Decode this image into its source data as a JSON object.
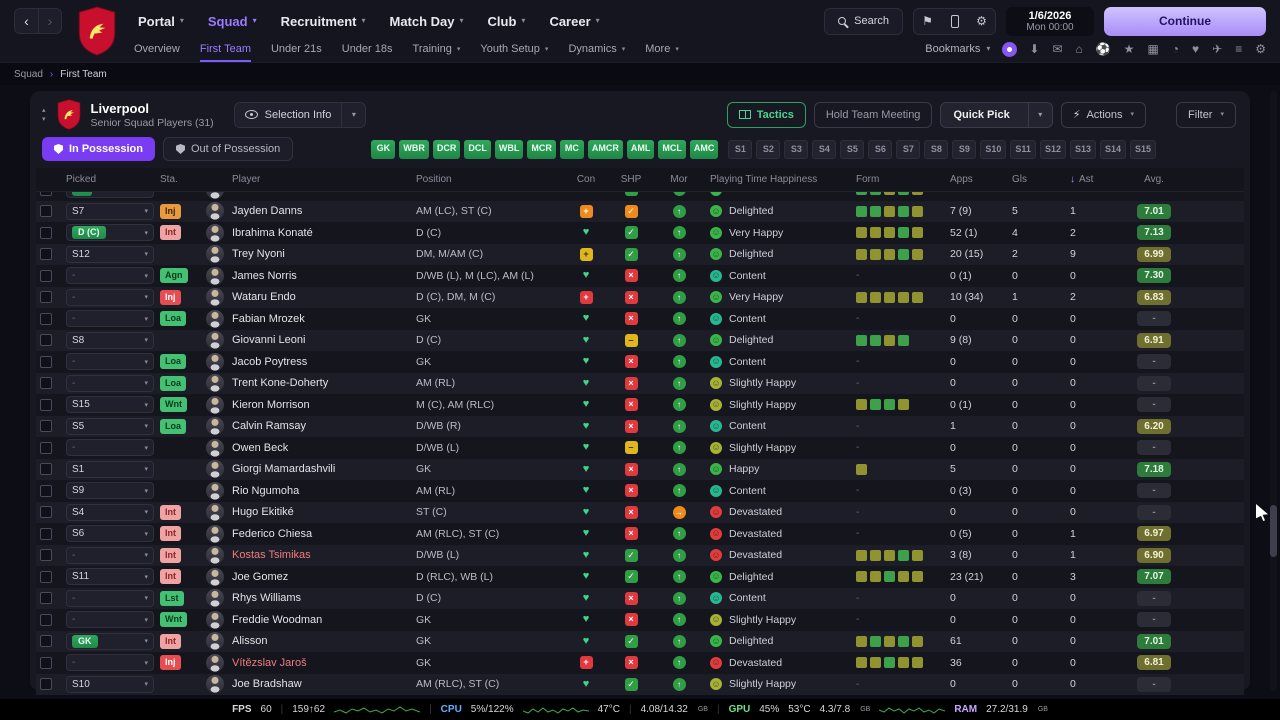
{
  "topbar": {
    "back": "‹",
    "forward": "›",
    "nav": [
      {
        "label": "Portal"
      },
      {
        "label": "Squad",
        "active": true
      },
      {
        "label": "Recruitment"
      },
      {
        "label": "Match Day"
      },
      {
        "label": "Club"
      },
      {
        "label": "Career"
      }
    ],
    "search_label": "Search",
    "date_line1": "1/6/2026",
    "date_line2": "Mon 00:00",
    "continue_label": "Continue"
  },
  "subnav": {
    "items": [
      {
        "label": "Overview"
      },
      {
        "label": "First Team",
        "active": true
      },
      {
        "label": "Under 21s"
      },
      {
        "label": "Under 18s"
      },
      {
        "label": "Training",
        "caret": true
      },
      {
        "label": "Youth Setup",
        "caret": true
      },
      {
        "label": "Dynamics",
        "caret": true
      },
      {
        "label": "More",
        "caret": true
      }
    ],
    "bookmarks_label": "Bookmarks",
    "icons": [
      {
        "name": "downloads-icon",
        "glyph": "⬇"
      },
      {
        "name": "mail-icon",
        "glyph": "✉"
      },
      {
        "name": "home-icon",
        "glyph": "⌂"
      },
      {
        "name": "club-icon",
        "glyph": "⚽"
      },
      {
        "name": "favourites-icon",
        "glyph": "★"
      },
      {
        "name": "calendar-icon",
        "glyph": "▦"
      },
      {
        "name": "history-icon",
        "glyph": "◔"
      },
      {
        "name": "medical-icon",
        "glyph": "♥"
      },
      {
        "name": "travel-icon",
        "glyph": "✈"
      },
      {
        "name": "menu-icon",
        "glyph": "≡"
      },
      {
        "name": "preferences-icon",
        "glyph": "⚙"
      }
    ]
  },
  "breadcrumb": [
    "Squad",
    "First Team"
  ],
  "panel": {
    "club_name": "Liverpool",
    "subtitle": "Senior Squad Players (31)",
    "selection_info_label": "Selection Info",
    "tactics_label": "Tactics",
    "meeting_label": "Hold Team Meeting",
    "quick_pick_label": "Quick Pick",
    "actions_label": "Actions",
    "filter_label": "Filter",
    "in_possession_label": "In Possession",
    "out_possession_label": "Out of Possession",
    "position_chips": [
      "GK",
      "WBR",
      "DCR",
      "DCL",
      "WBL",
      "MCR",
      "MC",
      "AMCR",
      "AML",
      "MCL",
      "AMC"
    ],
    "slot_chips": [
      "S1",
      "S2",
      "S3",
      "S4",
      "S5",
      "S6",
      "S7",
      "S8",
      "S9",
      "S10",
      "S11",
      "S12",
      "S13",
      "S14",
      "S15"
    ]
  },
  "table": {
    "headers": {
      "picked": "Picked",
      "sta": "Sta.",
      "player": "Player",
      "position": "Position",
      "con": "Con",
      "shp": "SHP",
      "mor": "Mor",
      "happiness": "Playing Time Happiness",
      "form": "Form",
      "apps": "Apps",
      "gls": "Gls",
      "ast": "Ast",
      "avg": "Avg.",
      "sort_icon": "↓"
    },
    "rows": [
      {
        "partial": true,
        "picked_label": "",
        "picked_type": "pos",
        "sta_label": "",
        "sta_color": "",
        "name": "",
        "name_red": false,
        "position": "",
        "con": "heart",
        "shp": "check",
        "mor": "up",
        "hap_label": "",
        "hap_color": "green",
        "form": [
          "g",
          "g",
          "o",
          "g",
          "o"
        ],
        "apps": "",
        "gls": "",
        "ast": "",
        "avg": "",
        "avg_level": "hidden"
      },
      {
        "partial": false,
        "picked_label": "S7",
        "picked_type": "slot",
        "sta_label": "Inj",
        "sta_color": "orange",
        "name": "Jayden Danns",
        "name_red": false,
        "position": "AM (LC), ST (C)",
        "con": "knock",
        "shp": "okay",
        "mor": "up",
        "hap_label": "Delighted",
        "hap_color": "green",
        "form": [
          "g",
          "g",
          "o",
          "g",
          "o"
        ],
        "apps": "7 (9)",
        "gls": "5",
        "ast": "1",
        "avg": "7.01",
        "avg_level": "good"
      },
      {
        "partial": false,
        "picked_label": "D (C)",
        "picked_type": "pos",
        "sta_label": "Int",
        "sta_color": "pink",
        "name": "Ibrahima Konaté",
        "name_red": false,
        "position": "D (C)",
        "con": "heart",
        "shp": "check",
        "mor": "up",
        "hap_label": "Very Happy",
        "hap_color": "green",
        "form": [
          "o",
          "o",
          "o",
          "g",
          "o"
        ],
        "apps": "52 (1)",
        "gls": "4",
        "ast": "2",
        "avg": "7.13",
        "avg_level": "good"
      },
      {
        "partial": false,
        "picked_label": "S12",
        "picked_type": "slot",
        "sta_label": "",
        "sta_color": "",
        "name": "Trey Nyoni",
        "name_red": false,
        "position": "DM, M/AM (C)",
        "con": "warn",
        "shp": "check",
        "mor": "up",
        "hap_label": "Delighted",
        "hap_color": "green",
        "form": [
          "o",
          "o",
          "o",
          "g",
          "o"
        ],
        "apps": "20 (15)",
        "gls": "2",
        "ast": "9",
        "avg": "6.99",
        "avg_level": "ok"
      },
      {
        "partial": false,
        "picked_label": "-",
        "picked_type": "dash",
        "sta_label": "Agn",
        "sta_color": "green",
        "name": "James Norris",
        "name_red": false,
        "position": "D/WB (L), M (LC), AM (L)",
        "con": "heart",
        "shp": "cross",
        "mor": "up",
        "hap_label": "Content",
        "hap_color": "teal",
        "form": null,
        "apps": "0 (1)",
        "gls": "0",
        "ast": "0",
        "avg": "7.30",
        "avg_level": "good"
      },
      {
        "partial": false,
        "picked_label": "-",
        "picked_type": "dash",
        "sta_label": "Inj",
        "sta_color": "red",
        "name": "Wataru Endo",
        "name_red": false,
        "position": "D (C), DM, M (C)",
        "con": "cross",
        "shp": "cross",
        "mor": "up",
        "hap_label": "Very Happy",
        "hap_color": "green",
        "form": [
          "o",
          "o",
          "o",
          "o",
          "o"
        ],
        "apps": "10 (34)",
        "gls": "1",
        "ast": "2",
        "avg": "6.83",
        "avg_level": "ok"
      },
      {
        "partial": false,
        "picked_label": "-",
        "picked_type": "dash",
        "sta_label": "Loa",
        "sta_color": "green",
        "name": "Fabian Mrozek",
        "name_red": false,
        "position": "GK",
        "con": "heart",
        "shp": "cross",
        "mor": "up",
        "hap_label": "Content",
        "hap_color": "teal",
        "form": null,
        "apps": "0",
        "gls": "0",
        "ast": "0",
        "avg": "-",
        "avg_level": "none"
      },
      {
        "partial": false,
        "picked_label": "S8",
        "picked_type": "slot",
        "sta_label": "",
        "sta_color": "",
        "name": "Giovanni Leoni",
        "name_red": false,
        "position": "D (C)",
        "con": "heart",
        "shp": "dash",
        "mor": "up",
        "hap_label": "Delighted",
        "hap_color": "green",
        "form": [
          "g",
          "g",
          "o",
          "g"
        ],
        "apps": "9 (8)",
        "gls": "0",
        "ast": "0",
        "avg": "6.91",
        "avg_level": "ok"
      },
      {
        "partial": false,
        "picked_label": "-",
        "picked_type": "dash",
        "sta_label": "Loa",
        "sta_color": "green",
        "name": "Jacob Poytress",
        "name_red": false,
        "position": "GK",
        "con": "heart",
        "shp": "cross",
        "mor": "up",
        "hap_label": "Content",
        "hap_color": "teal",
        "form": null,
        "apps": "0",
        "gls": "0",
        "ast": "0",
        "avg": "-",
        "avg_level": "none"
      },
      {
        "partial": false,
        "picked_label": "-",
        "picked_type": "dash",
        "sta_label": "Loa",
        "sta_color": "green",
        "name": "Trent Kone-Doherty",
        "name_red": false,
        "position": "AM (RL)",
        "con": "heart",
        "shp": "cross",
        "mor": "up",
        "hap_label": "Slightly Happy",
        "hap_color": "olive",
        "form": null,
        "apps": "0",
        "gls": "0",
        "ast": "0",
        "avg": "-",
        "avg_level": "none"
      },
      {
        "partial": false,
        "picked_label": "S15",
        "picked_type": "slot",
        "sta_label": "Wnt",
        "sta_color": "green",
        "name": "Kieron Morrison",
        "name_red": false,
        "position": "M (C), AM (RLC)",
        "con": "heart",
        "shp": "cross",
        "mor": "up",
        "hap_label": "Slightly Happy",
        "hap_color": "olive",
        "form": [
          "o",
          "g",
          "g",
          "o"
        ],
        "apps": "0 (1)",
        "gls": "0",
        "ast": "0",
        "avg": "-",
        "avg_level": "none"
      },
      {
        "partial": false,
        "picked_label": "S5",
        "picked_type": "slot",
        "sta_label": "Loa",
        "sta_color": "green",
        "name": "Calvin Ramsay",
        "name_red": false,
        "position": "D/WB (R)",
        "con": "heart",
        "shp": "cross",
        "mor": "up",
        "hap_label": "Content",
        "hap_color": "teal",
        "form": null,
        "apps": "1",
        "gls": "0",
        "ast": "0",
        "avg": "6.20",
        "avg_level": "ok"
      },
      {
        "partial": false,
        "picked_label": "-",
        "picked_type": "dash",
        "sta_label": "",
        "sta_color": "",
        "name": "Owen Beck",
        "name_red": false,
        "position": "D/WB (L)",
        "con": "heart",
        "shp": "dash",
        "mor": "up",
        "hap_label": "Slightly Happy",
        "hap_color": "olive",
        "form": null,
        "apps": "0",
        "gls": "0",
        "ast": "0",
        "avg": "-",
        "avg_level": "none"
      },
      {
        "partial": false,
        "picked_label": "S1",
        "picked_type": "slot",
        "sta_label": "",
        "sta_color": "",
        "name": "Giorgi Mamardashvili",
        "name_red": false,
        "position": "GK",
        "con": "heart",
        "shp": "cross",
        "mor": "up",
        "hap_label": "Happy",
        "hap_color": "green",
        "form": [
          "o"
        ],
        "apps": "5",
        "gls": "0",
        "ast": "0",
        "avg": "7.18",
        "avg_level": "good"
      },
      {
        "partial": false,
        "picked_label": "S9",
        "picked_type": "slot",
        "sta_label": "",
        "sta_color": "",
        "name": "Rio Ngumoha",
        "name_red": false,
        "position": "AM (RL)",
        "con": "heart",
        "shp": "cross",
        "mor": "up",
        "hap_label": "Content",
        "hap_color": "teal",
        "form": null,
        "apps": "0 (3)",
        "gls": "0",
        "ast": "0",
        "avg": "-",
        "avg_level": "none"
      },
      {
        "partial": false,
        "picked_label": "S4",
        "picked_type": "slot",
        "sta_label": "Int",
        "sta_color": "pink",
        "name": "Hugo Ekitiké",
        "name_red": false,
        "position": "ST (C)",
        "con": "heart",
        "shp": "cross",
        "mor": "flat",
        "hap_label": "Devastated",
        "hap_color": "red",
        "form": null,
        "apps": "0",
        "gls": "0",
        "ast": "0",
        "avg": "-",
        "avg_level": "none"
      },
      {
        "partial": false,
        "picked_label": "S6",
        "picked_type": "slot",
        "sta_label": "Int",
        "sta_color": "pink",
        "name": "Federico Chiesa",
        "name_red": false,
        "position": "AM (RLC), ST (C)",
        "con": "heart",
        "shp": "cross",
        "mor": "up",
        "hap_label": "Devastated",
        "hap_color": "red",
        "form": null,
        "apps": "0 (5)",
        "gls": "0",
        "ast": "1",
        "avg": "6.97",
        "avg_level": "ok"
      },
      {
        "partial": false,
        "picked_label": "-",
        "picked_type": "dash",
        "sta_label": "Int",
        "sta_color": "pink",
        "name": "Kostas Tsimikas",
        "name_red": true,
        "position": "D/WB (L)",
        "con": "heart",
        "shp": "check",
        "mor": "up",
        "hap_label": "Devastated",
        "hap_color": "red",
        "form": [
          "o",
          "o",
          "o",
          "g",
          "o"
        ],
        "apps": "3 (8)",
        "gls": "0",
        "ast": "1",
        "avg": "6.90",
        "avg_level": "ok"
      },
      {
        "partial": false,
        "picked_label": "S11",
        "picked_type": "slot",
        "sta_label": "Int",
        "sta_color": "pink",
        "name": "Joe Gomez",
        "name_red": false,
        "position": "D (RLC), WB (L)",
        "con": "heart",
        "shp": "check",
        "mor": "up",
        "hap_label": "Delighted",
        "hap_color": "green",
        "form": [
          "o",
          "o",
          "g",
          "o",
          "o"
        ],
        "apps": "23 (21)",
        "gls": "0",
        "ast": "3",
        "avg": "7.07",
        "avg_level": "good"
      },
      {
        "partial": false,
        "picked_label": "-",
        "picked_type": "dash",
        "sta_label": "Lst",
        "sta_color": "green",
        "name": "Rhys Williams",
        "name_red": false,
        "position": "D (C)",
        "con": "heart",
        "shp": "cross",
        "mor": "up",
        "hap_label": "Content",
        "hap_color": "teal",
        "form": null,
        "apps": "0",
        "gls": "0",
        "ast": "0",
        "avg": "-",
        "avg_level": "none"
      },
      {
        "partial": false,
        "picked_label": "-",
        "picked_type": "dash",
        "sta_label": "Wnt",
        "sta_color": "green",
        "name": "Freddie Woodman",
        "name_red": false,
        "position": "GK",
        "con": "heart",
        "shp": "cross",
        "mor": "up",
        "hap_label": "Slightly Happy",
        "hap_color": "olive",
        "form": null,
        "apps": "0",
        "gls": "0",
        "ast": "0",
        "avg": "-",
        "avg_level": "none"
      },
      {
        "partial": false,
        "picked_label": "GK",
        "picked_type": "pos",
        "sta_label": "Int",
        "sta_color": "pink",
        "name": "Alisson",
        "name_red": false,
        "position": "GK",
        "con": "heart",
        "shp": "check",
        "mor": "up",
        "hap_label": "Delighted",
        "hap_color": "green",
        "form": [
          "o",
          "g",
          "o",
          "g",
          "o"
        ],
        "apps": "61",
        "gls": "0",
        "ast": "0",
        "avg": "7.01",
        "avg_level": "good"
      },
      {
        "partial": false,
        "picked_label": "-",
        "picked_type": "dash",
        "sta_label": "Inj",
        "sta_color": "red",
        "name": "Vítězslav Jaroš",
        "name_red": true,
        "position": "GK",
        "con": "cross",
        "shp": "cross",
        "mor": "up",
        "hap_label": "Devastated",
        "hap_color": "red",
        "form": [
          "o",
          "o",
          "g",
          "o",
          "o"
        ],
        "apps": "36",
        "gls": "0",
        "ast": "0",
        "avg": "6.81",
        "avg_level": "ok"
      },
      {
        "partial": false,
        "picked_label": "S10",
        "picked_type": "slot",
        "sta_label": "",
        "sta_color": "",
        "name": "Joe Bradshaw",
        "name_red": false,
        "position": "AM (RLC), ST (C)",
        "con": "heart",
        "shp": "check",
        "mor": "up",
        "hap_label": "Slightly Happy",
        "hap_color": "olive",
        "form": null,
        "apps": "0",
        "gls": "0",
        "ast": "0",
        "avg": "-",
        "avg_level": "none"
      }
    ]
  },
  "statusbar": {
    "fps_label": "FPS",
    "fps_value": "60",
    "net_value": "159↑62",
    "cpu_label": "CPU",
    "cpu_value": "5%/122%",
    "cpu_temp": "47°C",
    "sys_mem": "4.08/14.32",
    "unit_gb": "GB",
    "gpu_label": "GPU",
    "gpu_value": "45%",
    "gpu_temp": "53°C",
    "gpu_mem": "4.3/7.8",
    "ram_label": "RAM",
    "ram_value": "27.2/31.9"
  },
  "colors": {
    "accent_purple": "#8b5cf6",
    "accent_green": "#2f9e5b",
    "lfc_red": "#c8102e"
  }
}
